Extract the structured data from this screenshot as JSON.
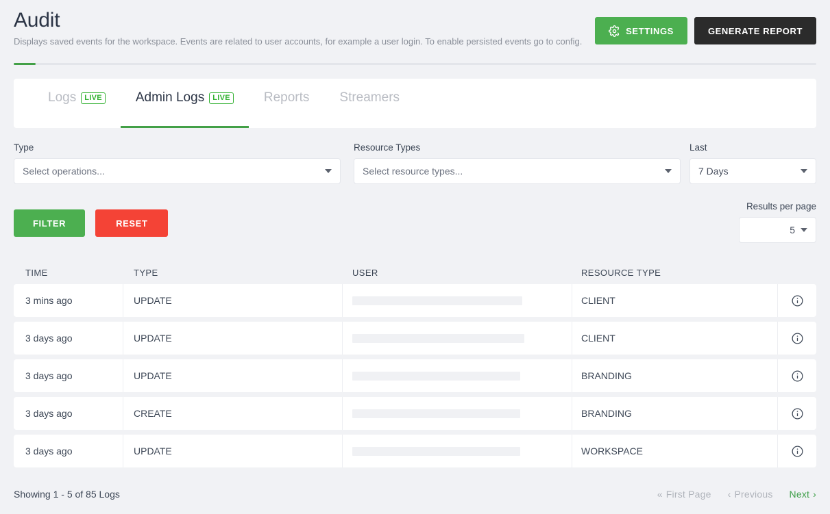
{
  "header": {
    "title": "Audit",
    "subtitle": "Displays saved events for the workspace. Events are related to user accounts, for example a user login. To enable persisted events go to config.",
    "settings_label": "SETTINGS",
    "generate_label": "GENERATE REPORT",
    "settings_icon": "gear-icon"
  },
  "colors": {
    "accent_green": "#43a047",
    "button_green": "#4caf50",
    "button_red": "#f44336",
    "dark": "#2b2b2b",
    "live_green": "#34b233",
    "text_dark": "#3d4756",
    "page_bg": "#f1f2f5"
  },
  "tabs": [
    {
      "label": "Logs",
      "badge": "LIVE",
      "active": false
    },
    {
      "label": "Admin Logs",
      "badge": "LIVE",
      "active": true
    },
    {
      "label": "Reports",
      "badge": "",
      "active": false
    },
    {
      "label": "Streamers",
      "badge": "",
      "active": false
    }
  ],
  "filters": {
    "type_label": "Type",
    "type_placeholder": "Select operations...",
    "type_value": "",
    "resource_label": "Resource Types",
    "resource_placeholder": "Select resource types...",
    "resource_value": "",
    "last_label": "Last",
    "last_value": "7 Days",
    "filter_button": "FILTER",
    "reset_button": "RESET",
    "results_per_page_label": "Results per page",
    "results_per_page_value": "5"
  },
  "table": {
    "columns": [
      "TIME",
      "TYPE",
      "USER",
      "RESOURCE TYPE"
    ],
    "rows": [
      {
        "time": "3 mins ago",
        "type": "UPDATE",
        "user": "",
        "resource": "CLIENT",
        "user_redacted_width": 248
      },
      {
        "time": "3 days ago",
        "type": "UPDATE",
        "user": "",
        "resource": "CLIENT",
        "user_redacted_width": 251
      },
      {
        "time": "3 days ago",
        "type": "UPDATE",
        "user": "",
        "resource": "BRANDING",
        "user_redacted_width": 245
      },
      {
        "time": "3 days ago",
        "type": "CREATE",
        "user": "",
        "resource": "BRANDING",
        "user_redacted_width": 245
      },
      {
        "time": "3 days ago",
        "type": "UPDATE",
        "user": "",
        "resource": "WORKSPACE",
        "user_redacted_width": 245
      }
    ],
    "row_action_icon": "info-icon"
  },
  "footer": {
    "showing": "Showing 1 - 5 of 85 Logs",
    "first_page": "First Page",
    "previous": "Previous",
    "next": "Next"
  }
}
